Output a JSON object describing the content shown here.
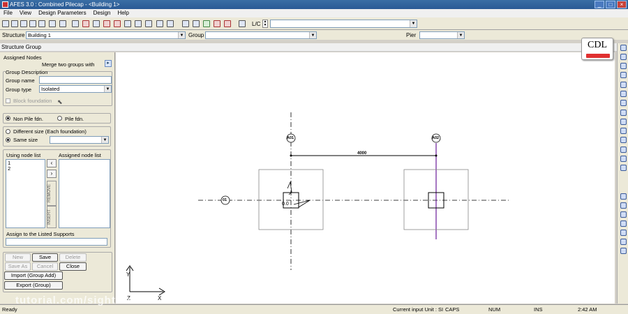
{
  "window": {
    "title": "AFES 3.0 : Combined Pilecap - <Building 1>"
  },
  "menu": {
    "items": [
      "File",
      "View",
      "Design Parameters",
      "Design",
      "Help"
    ]
  },
  "toolbar": {
    "lc_label": "L/C",
    "lc_value": ""
  },
  "structure_bar": {
    "structure_label": "Structure",
    "structure_value": "Building 1",
    "group_label": "Group",
    "group_value": "",
    "pier_label": "Pier",
    "pier_value": ""
  },
  "panel": {
    "title": "Structure Group",
    "assigned_nodes_label": "Assigned Nodes",
    "merge_label": "Merge two groups with",
    "group_description_label": "Group Description",
    "group_name_label": "Group name",
    "group_name_value": "",
    "group_type_label": "Group type",
    "group_type_value": "Isolated",
    "block_foundation_label": "Block foundation",
    "fdn_options": [
      {
        "label": "Non Pile fdn.",
        "selected": true
      },
      {
        "label": "Pile fdn.",
        "selected": false
      }
    ],
    "size_options": [
      {
        "label": "Different size (Each foundation)",
        "selected": false
      },
      {
        "label": "Same size",
        "selected": true
      }
    ],
    "same_size_value": "",
    "using_node_list_label": "Using node list",
    "using_node_list": [
      "1",
      "2"
    ],
    "assigned_node_list_label": "Assigned node list",
    "assigned_node_list": [],
    "remove_label": "REMOVE",
    "insert_label": "INSERT",
    "assign_supports_label": "Assign to the Listed Supports",
    "assign_supports_value": "",
    "buttons": {
      "new": "New",
      "save": "Save",
      "delete": "Delete",
      "save_as": "Save As",
      "cancel": "Cancel",
      "close": "Close",
      "import": "Import (Group Add)",
      "export": "Export (Group)"
    }
  },
  "drawing": {
    "grid_labels": [
      "A01",
      "A02",
      "01"
    ],
    "dimension": "4000",
    "node_label": "0.0",
    "axis_labels": {
      "y": "Y",
      "x": "X",
      "z": "Z"
    }
  },
  "logo": {
    "text": "CDL",
    "accent": "#e03030"
  },
  "status": {
    "ready": "Ready",
    "unit": "Current input Unit : SI",
    "caps": "CAPS",
    "num": "NUM",
    "ins": "INS",
    "time": "2:42 AM"
  },
  "watermark": "tutorial.com/sight fo"
}
